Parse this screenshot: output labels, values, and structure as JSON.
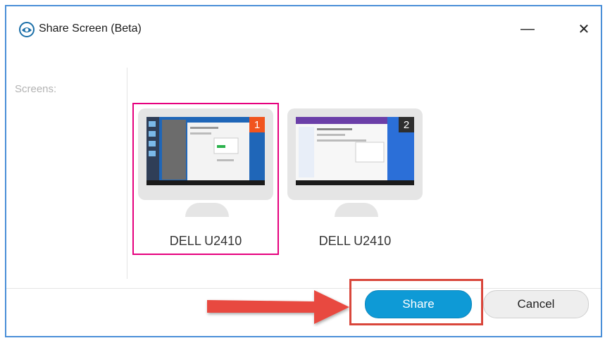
{
  "window": {
    "title": "Share Screen (Beta)",
    "minimize_glyph": "—",
    "close_glyph": "✕"
  },
  "sidebar": {
    "label": "Screens:"
  },
  "screens": [
    {
      "label": "DELL U2410",
      "badge": "1",
      "selected": true
    },
    {
      "label": "DELL U2410",
      "badge": "2",
      "selected": false
    }
  ],
  "footer": {
    "share_label": "Share",
    "cancel_label": "Cancel"
  },
  "colors": {
    "accent": "#0e9ad6",
    "selection": "#e6007e",
    "highlight": "#d9463b",
    "badge_1": "#f1541e",
    "badge_2": "#2e2e2e"
  },
  "icons": {
    "app": "screen-share-eye-icon",
    "arrow": "red-arrow-pointer"
  }
}
